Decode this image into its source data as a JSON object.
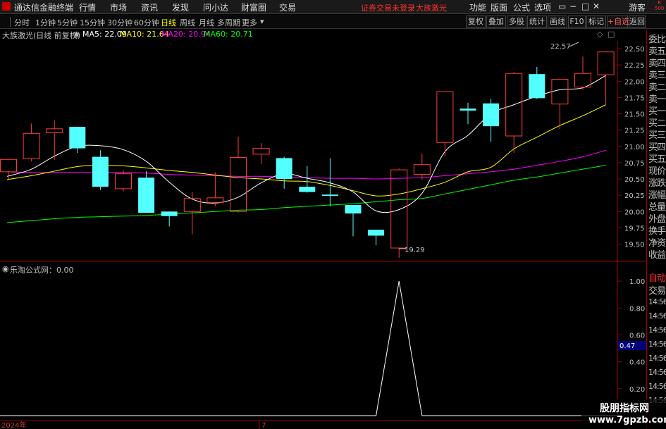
{
  "app": {
    "title": "通达信金融终端",
    "menus": [
      "行情",
      "市场",
      "资讯",
      "发现",
      "问小达",
      "财富圈",
      "交易"
    ],
    "notice": "证券交易未登录",
    "stock": "大族激光",
    "right_menus": [
      "功能",
      "版面",
      "公式",
      "选项"
    ],
    "guest": "游客"
  },
  "toolbar": {
    "periods": [
      "分时",
      "1分钟",
      "5分钟",
      "15分钟",
      "30分钟",
      "60分钟",
      "日线",
      "周线",
      "月线",
      "多周期",
      "更多"
    ],
    "right_buttons": [
      "复权",
      "叠加",
      "多股",
      "统计",
      "画线",
      "F10",
      "标记",
      "+自选",
      "返回"
    ],
    "active_period": "日线"
  },
  "info": {
    "stock_label": "大族激光(日线 前复权)",
    "ma": [
      {
        "label": "MA5: 22.09",
        "color": "#ffffff"
      },
      {
        "label": "MA10: 21.64",
        "color": "#ffff00"
      },
      {
        "label": "MA20: 20.94",
        "color": "#ff00ff"
      },
      {
        "label": "MA60: 20.71",
        "color": "#00ff00"
      }
    ],
    "indicator_label": "乐淘公式网：0.00"
  },
  "price_axis": {
    "ticks": [
      "22.50",
      "22.25",
      "22.00",
      "21.75",
      "21.50",
      "21.25",
      "21.00",
      "20.75",
      "20.50",
      "20.25",
      "20.00",
      "19.75",
      "19.50"
    ]
  },
  "indicator_axis": {
    "ticks": [
      "1.00",
      "0.80",
      "0.60",
      "0.40",
      "0.20"
    ],
    "cursor_value": "0.47"
  },
  "annotations": {
    "high": "22.57",
    "low": "19.29"
  },
  "right_panel": {
    "labels": [
      "委比",
      "卖五",
      "卖四",
      "卖三",
      "卖二",
      "卖一",
      "买一",
      "买二",
      "买三",
      "买四",
      "买五",
      "现价",
      "涨跌",
      "涨幅",
      "总量",
      "外盘",
      "换手",
      "净资",
      "收益"
    ],
    "auto_label": "自动",
    "trade_label": "交易",
    "times": [
      "14:56",
      "14:56",
      "14:56",
      "14:56",
      "14:56",
      "14:56",
      "14:56",
      "14:56"
    ]
  },
  "date_axis": {
    "labels": [
      "2024年",
      "7"
    ]
  },
  "watermark": {
    "line1": "股朋指标网",
    "line2": "www.7gpzb.com"
  },
  "chart_data": {
    "type": "candlestick",
    "ylim": [
      19.3,
      22.62
    ],
    "candles": [
      {
        "o": 20.61,
        "c": 20.8,
        "h": 20.81,
        "l": 20.5,
        "up": true
      },
      {
        "o": 20.81,
        "c": 21.2,
        "h": 21.35,
        "l": 20.77,
        "up": true
      },
      {
        "o": 21.21,
        "c": 21.27,
        "h": 21.4,
        "l": 20.79,
        "up": true
      },
      {
        "o": 21.3,
        "c": 20.97,
        "h": 21.3,
        "l": 20.9,
        "up": false
      },
      {
        "o": 20.84,
        "c": 20.38,
        "h": 20.94,
        "l": 20.33,
        "up": false
      },
      {
        "o": 20.35,
        "c": 20.58,
        "h": 20.63,
        "l": 20.31,
        "up": true
      },
      {
        "o": 20.52,
        "c": 19.98,
        "h": 20.62,
        "l": 19.98,
        "up": false
      },
      {
        "o": 20.0,
        "c": 19.93,
        "h": 20.0,
        "l": 19.77,
        "up": false
      },
      {
        "o": 20.0,
        "c": 20.2,
        "h": 20.3,
        "l": 19.65,
        "up": true
      },
      {
        "o": 20.14,
        "c": 20.21,
        "h": 20.6,
        "l": 20.08,
        "up": true
      },
      {
        "o": 20.0,
        "c": 20.83,
        "h": 21.15,
        "l": 19.98,
        "up": true
      },
      {
        "o": 20.88,
        "c": 20.97,
        "h": 21.05,
        "l": 20.73,
        "up": true
      },
      {
        "o": 20.82,
        "c": 20.5,
        "h": 20.84,
        "l": 20.35,
        "up": false
      },
      {
        "o": 20.38,
        "c": 20.3,
        "h": 20.7,
        "l": 20.29,
        "up": false
      },
      {
        "o": 20.26,
        "c": 20.24,
        "h": 20.82,
        "l": 20.08,
        "up": false
      },
      {
        "o": 20.1,
        "c": 19.97,
        "h": 20.1,
        "l": 19.62,
        "up": false
      },
      {
        "o": 19.72,
        "c": 19.63,
        "h": 19.72,
        "l": 19.48,
        "up": false
      },
      {
        "o": 19.44,
        "c": 20.64,
        "h": 20.66,
        "l": 19.29,
        "up": true
      },
      {
        "o": 20.57,
        "c": 20.72,
        "h": 20.89,
        "l": 20.49,
        "up": true
      },
      {
        "o": 21.06,
        "c": 21.84,
        "h": 21.84,
        "l": 20.85,
        "up": true
      },
      {
        "o": 21.58,
        "c": 21.55,
        "h": 21.67,
        "l": 21.34,
        "up": false
      },
      {
        "o": 21.66,
        "c": 21.31,
        "h": 21.73,
        "l": 21.07,
        "up": false
      },
      {
        "o": 21.16,
        "c": 22.12,
        "h": 22.14,
        "l": 20.9,
        "up": true
      },
      {
        "o": 22.11,
        "c": 21.74,
        "h": 22.22,
        "l": 21.73,
        "up": false
      },
      {
        "o": 21.65,
        "c": 22.03,
        "h": 22.04,
        "l": 21.27,
        "up": true
      },
      {
        "o": 21.91,
        "c": 22.12,
        "h": 22.38,
        "l": 21.87,
        "up": true
      },
      {
        "o": 22.1,
        "c": 22.45,
        "h": 22.46,
        "l": 21.65,
        "up": true
      }
    ],
    "ma5": [
      20.54,
      20.65,
      20.85,
      21.0,
      21.01,
      20.95,
      20.77,
      20.45,
      20.19,
      20.13,
      20.22,
      20.44,
      20.58,
      20.51,
      20.44,
      20.3,
      20.01,
      20.03,
      20.28,
      20.92,
      21.17,
      21.5,
      21.64,
      21.77,
      21.87,
      21.9,
      22.09
    ],
    "ma10": [
      20.49,
      20.55,
      20.62,
      20.69,
      20.71,
      20.7,
      20.67,
      20.63,
      20.6,
      20.56,
      20.52,
      20.5,
      20.47,
      20.46,
      20.4,
      20.32,
      20.24,
      20.27,
      20.35,
      20.45,
      20.61,
      20.68,
      20.96,
      21.14,
      21.32,
      21.47,
      21.64
    ],
    "ma20": [
      20.61,
      20.6,
      20.6,
      20.6,
      20.6,
      20.6,
      20.59,
      20.57,
      20.56,
      20.55,
      20.54,
      20.54,
      20.53,
      20.52,
      20.51,
      20.51,
      20.5,
      20.51,
      20.52,
      20.55,
      20.58,
      20.61,
      20.65,
      20.71,
      20.77,
      20.84,
      20.94
    ],
    "ma60": [
      19.83,
      19.86,
      19.89,
      19.91,
      19.92,
      19.93,
      19.94,
      19.96,
      19.98,
      20.0,
      20.02,
      20.03,
      20.06,
      20.08,
      20.1,
      20.12,
      20.15,
      20.18,
      20.2,
      20.27,
      20.34,
      20.41,
      20.48,
      20.53,
      20.59,
      20.65,
      20.71
    ],
    "indicator": {
      "ylim": [
        0,
        1.1
      ],
      "values": [
        0,
        0,
        0,
        0,
        0,
        0,
        0,
        0,
        0,
        0,
        0,
        0,
        0,
        0,
        0,
        0,
        0,
        1,
        0,
        0,
        0,
        0,
        0,
        0,
        0,
        0,
        0
      ]
    }
  }
}
